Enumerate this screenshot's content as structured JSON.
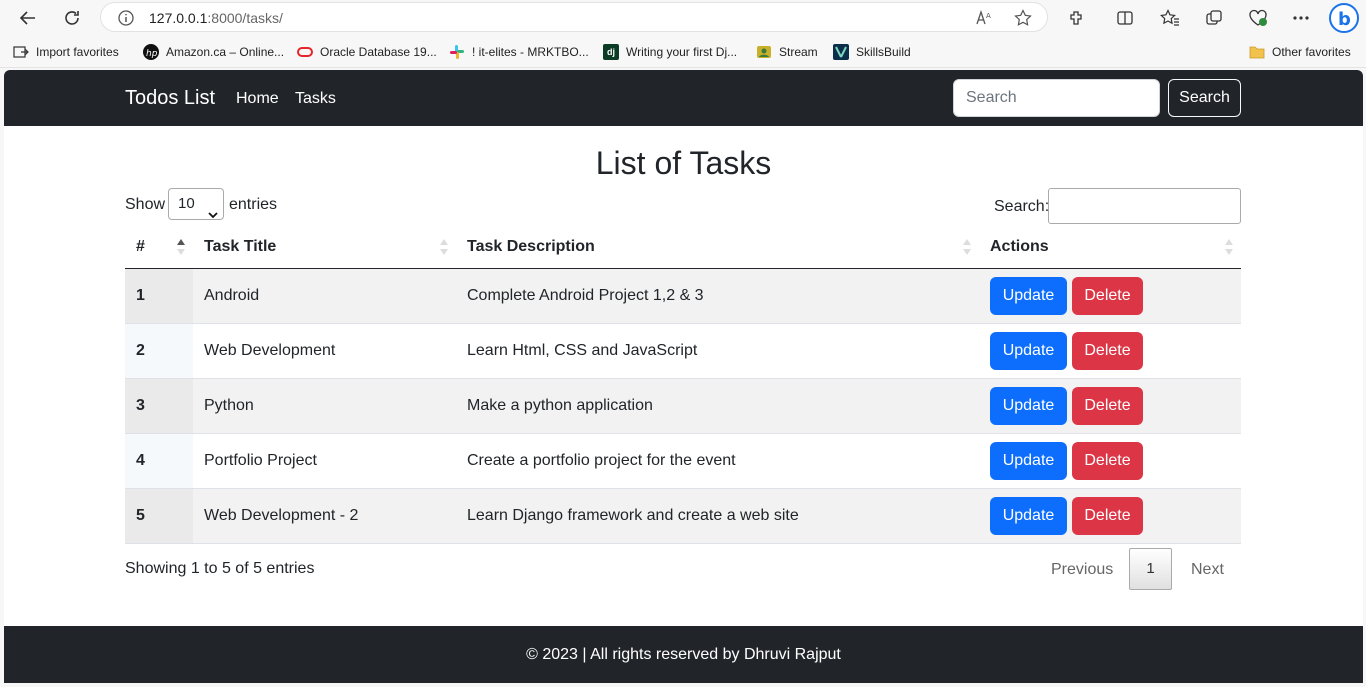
{
  "browser": {
    "url_host": "127.0.0.1",
    "url_rest": ":8000/tasks/",
    "bookmarks": [
      {
        "label": "Import favorites",
        "icon": "import-icon"
      },
      {
        "label": "Amazon.ca – Online...",
        "icon": "hp-icon"
      },
      {
        "label": "Oracle Database 19...",
        "icon": "oracle-icon"
      },
      {
        "label": "! it-elites - MRKTBO...",
        "icon": "slack-icon"
      },
      {
        "label": "Writing your first Dj...",
        "icon": "django-icon"
      },
      {
        "label": "Stream",
        "icon": "stream-icon"
      },
      {
        "label": "SkillsBuild",
        "icon": "skillsbuild-icon"
      },
      {
        "label": "Other favorites",
        "icon": "folder-icon"
      }
    ]
  },
  "navbar": {
    "brand": "Todos List",
    "links": [
      "Home",
      "Tasks"
    ],
    "search_placeholder": "Search",
    "search_button": "Search"
  },
  "page": {
    "title": "List of Tasks",
    "show_label": "Show",
    "entries_label": "entries",
    "page_length": "10",
    "search_label": "Search:",
    "columns": [
      "#",
      "Task Title",
      "Task Description",
      "Actions"
    ],
    "rows": [
      {
        "id": "1",
        "title": "Android",
        "description": "Complete Android Project 1,2 & 3"
      },
      {
        "id": "2",
        "title": "Web Development",
        "description": "Learn Html, CSS and JavaScript"
      },
      {
        "id": "3",
        "title": "Python",
        "description": "Make a python application"
      },
      {
        "id": "4",
        "title": "Portfolio Project",
        "description": "Create a portfolio project for the event"
      },
      {
        "id": "5",
        "title": "Web Development - 2",
        "description": "Learn Django framework and create a web site"
      }
    ],
    "update_label": "Update",
    "delete_label": "Delete",
    "info": "Showing 1 to 5 of 5 entries",
    "previous": "Previous",
    "current_page": "1",
    "next": "Next"
  },
  "footer": {
    "text": "© 2023 | All rights reserved by Dhruvi Rajput"
  },
  "colors": {
    "navbar": "#212529",
    "primary": "#0d6efd",
    "danger": "#dc3545"
  }
}
